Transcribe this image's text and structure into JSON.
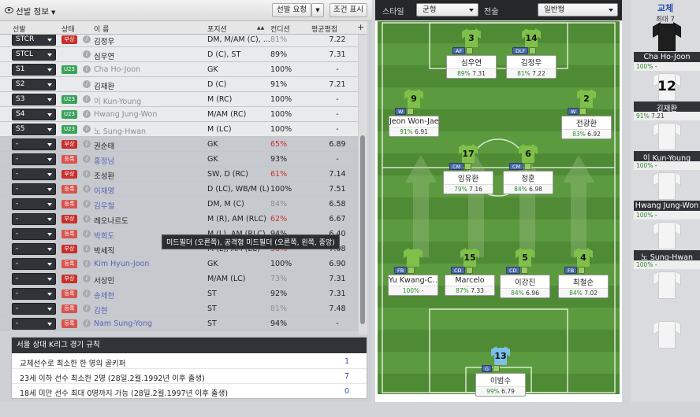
{
  "header": {
    "title": "선발 정보",
    "btn_request": "선발 요청",
    "btn_filter": "조건 표시"
  },
  "columns": {
    "selection": "선발",
    "status": "상태",
    "name": "이 름",
    "position": "포지션",
    "condition": "컨디션",
    "rating": "평균평점",
    "add": "+"
  },
  "rows": [
    {
      "sel": "STCR",
      "badge": "부상",
      "badge_type": "inj",
      "name": "김정우",
      "name_style": "",
      "pos": "DM, M/AM (C), ...",
      "cond": "81%",
      "cond_style": "gray",
      "rating": "7.22",
      "bg": "sel"
    },
    {
      "sel": "STCL",
      "badge": "",
      "badge_type": "",
      "name": "심우연",
      "name_style": "",
      "pos": "D (C), ST",
      "cond": "89%",
      "cond_style": "",
      "rating": "7.31",
      "bg": "sel"
    },
    {
      "sel": "S1",
      "badge": "U23",
      "badge_type": "u23",
      "name": "Cha Ho-Joon",
      "name_style": "gray",
      "pos": "GK",
      "cond": "100%",
      "cond_style": "",
      "rating": "-",
      "bg": "sel"
    },
    {
      "sel": "S2",
      "badge": "",
      "badge_type": "",
      "name": "김재환",
      "name_style": "",
      "pos": "D (C)",
      "cond": "91%",
      "cond_style": "",
      "rating": "7.21",
      "bg": "sel"
    },
    {
      "sel": "S3",
      "badge": "U23",
      "badge_type": "u23",
      "name": "이 Kun-Young",
      "name_style": "gray",
      "pos": "M (RC)",
      "cond": "100%",
      "cond_style": "",
      "rating": "-",
      "bg": "sel"
    },
    {
      "sel": "S4",
      "badge": "U23",
      "badge_type": "u23",
      "name": "Hwang Jung-Won",
      "name_style": "gray",
      "pos": "M/AM (RC)",
      "cond": "100%",
      "cond_style": "",
      "rating": "-",
      "bg": "sel"
    },
    {
      "sel": "S5",
      "badge": "U23",
      "badge_type": "u23",
      "name": "노 Sung-Hwan",
      "name_style": "gray",
      "pos": "M (LC)",
      "cond": "100%",
      "cond_style": "",
      "rating": "-",
      "bg": "sel"
    },
    {
      "sel": "-",
      "badge": "부상",
      "badge_type": "inj",
      "name": "권순태",
      "name_style": "",
      "pos": "GK",
      "cond": "65%",
      "cond_style": "red",
      "rating": "6.89",
      "bg": "res"
    },
    {
      "sel": "-",
      "badge": "등록",
      "badge_type": "reg",
      "name": "홍정남",
      "name_style": "blue",
      "pos": "GK",
      "cond": "93%",
      "cond_style": "",
      "rating": "-",
      "bg": "res"
    },
    {
      "sel": "-",
      "badge": "부상",
      "badge_type": "inj",
      "name": "조성환",
      "name_style": "",
      "pos": "SW, D (RC)",
      "cond": "61%",
      "cond_style": "red",
      "rating": "7.14",
      "bg": "res"
    },
    {
      "sel": "-",
      "badge": "등록",
      "badge_type": "reg",
      "name": "이재명",
      "name_style": "blue",
      "pos": "D (LC), WB/M (L)",
      "cond": "100%",
      "cond_style": "",
      "rating": "7.51",
      "bg": "res"
    },
    {
      "sel": "-",
      "badge": "등록",
      "badge_type": "reg",
      "name": "김우철",
      "name_style": "blue",
      "pos": "DM, M (C)",
      "cond": "84%",
      "cond_style": "gray",
      "rating": "6.58",
      "bg": "res"
    },
    {
      "sel": "-",
      "badge": "부상",
      "badge_type": "inj",
      "name": "레오나르도",
      "name_style": "",
      "pos": "M (R), AM (RLC)",
      "cond": "62%",
      "cond_style": "red",
      "rating": "6.67",
      "bg": "res"
    },
    {
      "sel": "-",
      "badge": "등록",
      "badge_type": "reg",
      "name": "박희도",
      "name_style": "blue",
      "pos": "M (L), AM (RLC)",
      "cond": "94%",
      "cond_style": "",
      "rating": "6.40",
      "bg": "res"
    },
    {
      "sel": "-",
      "badge": "부상",
      "badge_type": "inj",
      "name": "박세직",
      "name_style": "",
      "pos": "M (L), AM (LC)",
      "cond": "58%",
      "cond_style": "red",
      "rating": "7.08",
      "bg": "res"
    },
    {
      "sel": "-",
      "badge": "등록",
      "badge_type": "reg",
      "name": "Kim Hyun-Joon",
      "name_style": "blue",
      "pos": "GK",
      "cond": "100%",
      "cond_style": "",
      "rating": "6.90",
      "bg": "res"
    },
    {
      "sel": "-",
      "badge": "부상",
      "badge_type": "inj",
      "name": "서상민",
      "name_style": "",
      "pos": "M/AM (LC)",
      "cond": "73%",
      "cond_style": "gray",
      "rating": "7.31",
      "bg": "res"
    },
    {
      "sel": "-",
      "badge": "등록",
      "badge_type": "reg",
      "name": "송제헌",
      "name_style": "blue",
      "pos": "ST",
      "cond": "92%",
      "cond_style": "",
      "rating": "7.31",
      "bg": "res"
    },
    {
      "sel": "-",
      "badge": "등록",
      "badge_type": "reg",
      "name": "김현",
      "name_style": "blue",
      "pos": "ST",
      "cond": "81%",
      "cond_style": "gray",
      "rating": "7.48",
      "bg": "res"
    },
    {
      "sel": "-",
      "badge": "등록",
      "badge_type": "reg",
      "name": "Nam Sung-Yong",
      "name_style": "blue",
      "pos": "ST",
      "cond": "94%",
      "cond_style": "",
      "rating": "-",
      "bg": "res"
    }
  ],
  "tooltip": "미드필더 (오른쪽), 공격형 미드필더 (오른쪽, 왼쪽, 중앙)",
  "rules": {
    "title": "서울 상대 K리그 경기 규칙",
    "items": [
      {
        "text": "교체선수로 최소한 한 명의 골키퍼",
        "value": "1"
      },
      {
        "text": "23세 이하 선수 최소한 2명 (28일.2월.1992년 이후 출생)",
        "value": "7"
      },
      {
        "text": "18세 미만 선수 최대 0명까지 가능 (28일.2월.1997년 이후 출생)",
        "value": "0"
      }
    ]
  },
  "tactics": {
    "style_label": "스타일",
    "style_value": "균형",
    "tactic_label": "전술",
    "tactic_value": "일반형"
  },
  "players": [
    {
      "num": "3",
      "role": "AF",
      "name": "심우연",
      "cond": "89%",
      "rating": "7.31",
      "gk": false
    },
    {
      "num": "14",
      "role": "DLF",
      "name": "김정우",
      "cond": "81%",
      "rating": "7.22",
      "gk": false
    },
    {
      "num": "9",
      "role": "W",
      "name": "Jeon Won-Jae",
      "cond": "91%",
      "rating": "6.91",
      "gk": false
    },
    {
      "num": "2",
      "role": "W",
      "name": "전광환",
      "cond": "83%",
      "rating": "6.92",
      "gk": false
    },
    {
      "num": "17",
      "role": "CM",
      "name": "임유환",
      "cond": "79%",
      "rating": "7.16",
      "gk": false
    },
    {
      "num": "6",
      "role": "CM",
      "name": "정훈",
      "cond": "84%",
      "rating": "6.98",
      "gk": false
    },
    {
      "num": "",
      "role": "FB",
      "name": "Yu Kwang-C...",
      "cond": "100%",
      "rating": "-",
      "gk": false
    },
    {
      "num": "15",
      "role": "CD",
      "name": "Marcelo",
      "cond": "87%",
      "rating": "7.33",
      "gk": false
    },
    {
      "num": "5",
      "role": "CD",
      "name": "이강진",
      "cond": "84%",
      "rating": "6.96",
      "gk": false
    },
    {
      "num": "4",
      "role": "FB",
      "name": "최철순",
      "cond": "84%",
      "rating": "7.02",
      "gk": false
    },
    {
      "num": "13",
      "role": "G",
      "name": "이범수",
      "cond": "99%",
      "rating": "6.79",
      "gk": true
    }
  ],
  "subs": {
    "title": "교체",
    "max": "최대 7",
    "items": [
      {
        "num": "",
        "name": "Cha Ho-Joon",
        "cond": "100%",
        "rating": "-",
        "gk": true
      },
      {
        "num": "12",
        "name": "김재환",
        "cond": "91%",
        "rating": "7.21",
        "gk": false
      },
      {
        "num": "",
        "name": "이 Kun-Young",
        "cond": "100%",
        "rating": "-",
        "gk": false
      },
      {
        "num": "",
        "name": "Hwang Jung-Won",
        "cond": "100%",
        "rating": "-",
        "gk": false
      },
      {
        "num": "",
        "name": "노 Sung-Hwan",
        "cond": "100%",
        "rating": "-",
        "gk": false
      },
      {
        "num": "",
        "name": "",
        "cond": "",
        "rating": "",
        "gk": false
      },
      {
        "num": "",
        "name": "",
        "cond": "",
        "rating": "",
        "gk": false
      }
    ]
  }
}
